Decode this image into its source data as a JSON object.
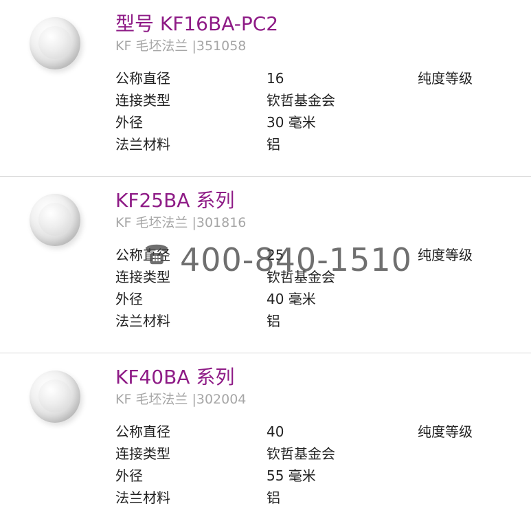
{
  "products": [
    {
      "title": "型号 KF16BA-PC2",
      "subtitle": "KF 毛坯法兰 |351058",
      "specs": [
        {
          "label": "公称直径",
          "value": "16",
          "extra": "纯度等级"
        },
        {
          "label": "连接类型",
          "value": "钦哲基金会",
          "extra": ""
        },
        {
          "label": "外径",
          "value": "30 毫米",
          "extra": ""
        },
        {
          "label": "法兰材料",
          "value": "铝",
          "extra": ""
        }
      ]
    },
    {
      "title": "KF25BA 系列",
      "subtitle": "KF 毛坯法兰 |301816",
      "specs": [
        {
          "label": "公称直径",
          "value": "25",
          "extra": "纯度等级"
        },
        {
          "label": "连接类型",
          "value": "钦哲基金会",
          "extra": ""
        },
        {
          "label": "外径",
          "value": "40 毫米",
          "extra": ""
        },
        {
          "label": "法兰材料",
          "value": "铝",
          "extra": ""
        }
      ]
    },
    {
      "title": "KF40BA 系列",
      "subtitle": "KF 毛坯法兰 |302004",
      "specs": [
        {
          "label": "公称直径",
          "value": "40",
          "extra": "纯度等级"
        },
        {
          "label": "连接类型",
          "value": "钦哲基金会",
          "extra": ""
        },
        {
          "label": "外径",
          "value": "55 毫米",
          "extra": ""
        },
        {
          "label": "法兰材料",
          "value": "铝",
          "extra": ""
        }
      ]
    }
  ],
  "watermark": {
    "phone": "400-840-1510",
    "icon": "phone-icon"
  },
  "colors": {
    "title": "#8e1b86",
    "subtitle": "#a6a6a6",
    "text": "#222222",
    "divider": "#d7d7d7"
  }
}
